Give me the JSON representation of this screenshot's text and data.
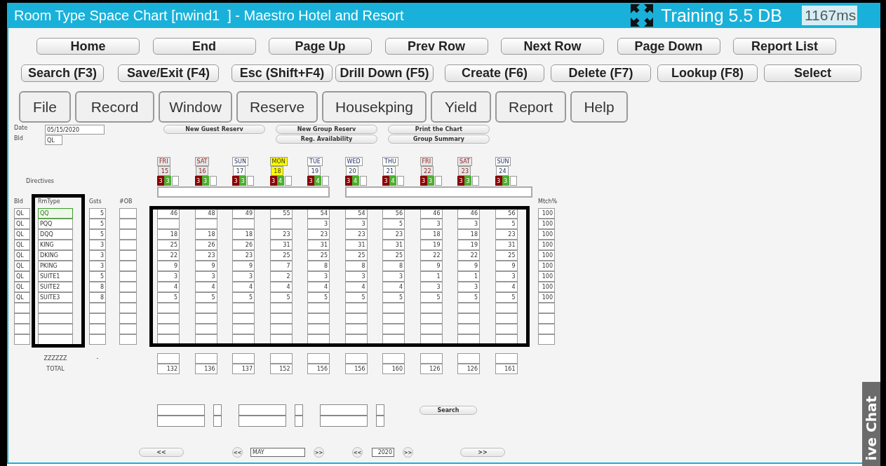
{
  "window": {
    "title": "Room Type Space Chart [nwind1  ] - Maestro Hotel and Resort",
    "db_label": "Training 5.5 DB",
    "timing": "1167ms"
  },
  "nav_buttons": [
    "Home",
    "End",
    "Page Up",
    "Prev Row",
    "Next Row",
    "Page Down",
    "Report List"
  ],
  "action_buttons": [
    "Search (F3)",
    "Save/Exit (F4)",
    "Esc (Shift+F4)",
    "Drill Down (F5)",
    "Create (F6)",
    "Delete (F7)",
    "Lookup (F8)",
    "Select"
  ],
  "menu_buttons": [
    "File",
    "Record",
    "Window",
    "Reserve",
    "Housekping",
    "Yield",
    "Report",
    "Help"
  ],
  "date": {
    "label": "Date",
    "value": "05/15/2020"
  },
  "bld": {
    "label": "Bld",
    "value": "QL"
  },
  "quick_buttons": [
    [
      "New Guest Reserv"
    ],
    [
      "New Group Reserv",
      "Reg. Availability"
    ],
    [
      "Print the Chart",
      "Group Summary"
    ]
  ],
  "directives_label": "Directives",
  "days": [
    {
      "name": "FRI",
      "date": "15",
      "kind": "weekend",
      "red": "3",
      "green": "3"
    },
    {
      "name": "SAT",
      "date": "16",
      "kind": "weekend",
      "red": "3",
      "green": "3"
    },
    {
      "name": "SUN",
      "date": "17",
      "kind": "weekday",
      "red": "3",
      "green": "3"
    },
    {
      "name": "MON",
      "date": "18",
      "kind": "today",
      "red": "3",
      "green": "4"
    },
    {
      "name": "TUE",
      "date": "19",
      "kind": "weekday",
      "red": "3",
      "green": "4"
    },
    {
      "name": "WED",
      "date": "20",
      "kind": "weekday",
      "red": "3",
      "green": "4"
    },
    {
      "name": "THU",
      "date": "21",
      "kind": "weekday",
      "red": "3",
      "green": "4"
    },
    {
      "name": "FRI",
      "date": "22",
      "kind": "weekend",
      "red": "3",
      "green": "3"
    },
    {
      "name": "SAT",
      "date": "23",
      "kind": "weekend",
      "red": "3",
      "green": "3"
    },
    {
      "name": "SUN",
      "date": "24",
      "kind": "weekday",
      "red": "3",
      "green": "3"
    }
  ],
  "columns": {
    "bld": "Bld",
    "rmtype": "RmType",
    "gsts": "Gsts",
    "ob": "#OB",
    "match": "Mtch%"
  },
  "rows": [
    {
      "bld": "QL",
      "rmtype": "QQ",
      "gsts": "5",
      "values": [
        "46",
        "48",
        "49",
        "55",
        "54",
        "54",
        "56",
        "46",
        "46",
        "56"
      ],
      "match": "100",
      "selected": true
    },
    {
      "bld": "QL",
      "rmtype": "PQQ",
      "gsts": "5",
      "values": [
        {
          "kind": "empty"
        },
        {
          "kind": "empty"
        },
        {
          "kind": "empty"
        },
        {
          "kind": "empty"
        },
        {
          "kind": "number",
          "text": "3"
        },
        {
          "kind": "number",
          "text": "3"
        },
        {
          "kind": "number",
          "text": "5"
        },
        {
          "kind": "number",
          "text": "3"
        },
        {
          "kind": "number",
          "text": "3"
        },
        {
          "kind": "number",
          "text": "5"
        }
      ],
      "match": "100",
      "selected": false
    },
    {
      "bld": "QL",
      "rmtype": "DQQ",
      "gsts": "5",
      "values": [
        "18",
        "18",
        "18",
        "23",
        "23",
        "23",
        "23",
        "18",
        "18",
        "23"
      ],
      "match": "100",
      "selected": false
    },
    {
      "bld": "QL",
      "rmtype": "KING",
      "gsts": "3",
      "values": [
        "25",
        "26",
        "26",
        "31",
        "31",
        "31",
        "31",
        "19",
        "19",
        "31"
      ],
      "match": "100",
      "selected": false
    },
    {
      "bld": "QL",
      "rmtype": "DKING",
      "gsts": "3",
      "values": [
        "22",
        "23",
        "23",
        "25",
        "25",
        "25",
        "25",
        "22",
        "22",
        "25"
      ],
      "match": "100",
      "selected": false
    },
    {
      "bld": "QL",
      "rmtype": "PKING",
      "gsts": "3",
      "values": [
        "9",
        "9",
        "9",
        "7",
        "8",
        "8",
        "8",
        "9",
        "9",
        "9"
      ],
      "match": "100",
      "selected": false
    },
    {
      "bld": "QL",
      "rmtype": "SUITE1",
      "gsts": "5",
      "values": [
        "3",
        "3",
        "3",
        "2",
        "3",
        "3",
        "3",
        "1",
        "1",
        "3"
      ],
      "match": "100",
      "selected": false
    },
    {
      "bld": "QL",
      "rmtype": "SUITE2",
      "gsts": "8",
      "values": [
        "4",
        "4",
        "4",
        "4",
        "4",
        "4",
        "4",
        "3",
        "3",
        "4"
      ],
      "match": "100",
      "selected": false
    },
    {
      "bld": "QL",
      "rmtype": "SUITE3",
      "gsts": "8",
      "values": [
        "5",
        "5",
        "5",
        "5",
        "5",
        "5",
        "5",
        "5",
        "5",
        "5"
      ],
      "match": "100",
      "selected": false
    }
  ],
  "summary": {
    "label": "ZZZZZZ",
    "gsts": "-"
  },
  "totals": {
    "label": "TOTAL",
    "values": [
      "132",
      "136",
      "137",
      "152",
      "156",
      "156",
      "160",
      "126",
      "126",
      "161"
    ]
  },
  "search_button": "Search",
  "month_nav": {
    "prev_page": "<<",
    "prev_month": "<<",
    "month": "MAY",
    "next_month": ">>",
    "prev_year": "<<",
    "year": "2020",
    "next_year": ">>",
    "next_page": ">>"
  },
  "live_chat": "ive Chat"
}
